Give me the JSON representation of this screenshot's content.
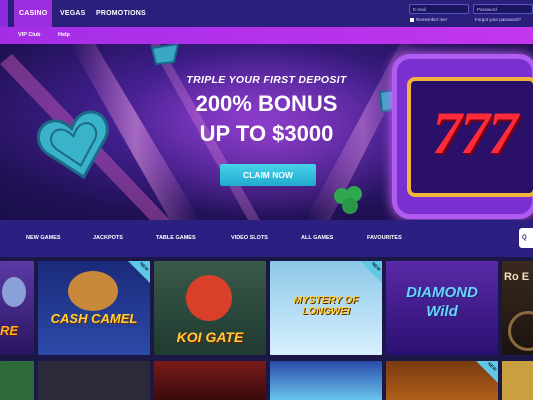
{
  "nav": {
    "items": [
      "CASINO",
      "VEGAS",
      "PROMOTIONS"
    ],
    "email_placeholder": "E-mail",
    "password_placeholder": "Password",
    "remember_me": "Remember me!",
    "forgot_password": "Forgot your password?"
  },
  "subnav": {
    "items": [
      "VIP Club",
      "Help"
    ]
  },
  "hero": {
    "line1": "TRIPLE YOUR FIRST DEPOSIT",
    "line2": "200% BONUS",
    "line3": "UP TO $3000",
    "cta": "CLAIM NOW",
    "slot_digits": "777"
  },
  "categories": [
    "NEW GAMES",
    "JACKPOTS",
    "TABLE GAMES",
    "VIDEO SLOTS",
    "ALL GAMES",
    "FAVOURITES"
  ],
  "search_label": "Q",
  "games": [
    {
      "title": "RE",
      "new": false
    },
    {
      "title": "CASH CAMEL",
      "new": true
    },
    {
      "title": "KOI GATE",
      "new": false
    },
    {
      "title": "MYSTERY OF LONGWEI",
      "new": true
    },
    {
      "title": "DIAMOND Wild",
      "new": false
    },
    {
      "title": "Ro E",
      "new": false
    }
  ],
  "badge_label": "NEW",
  "colors": {
    "nav": "#2a1f7a",
    "active_tab": "#9d2ee0",
    "subnav": "#b232ea",
    "cta": "#2fbfdc",
    "badge": "#5fc9e6"
  }
}
